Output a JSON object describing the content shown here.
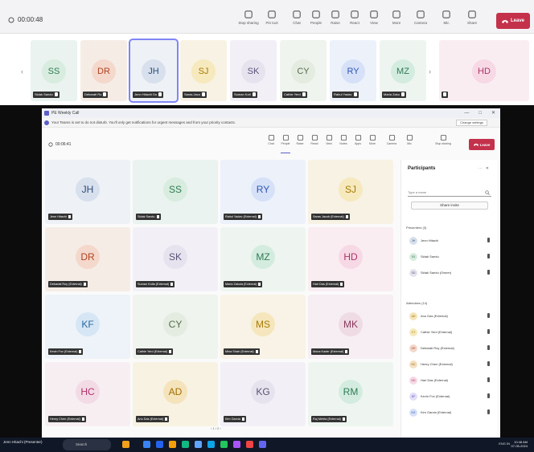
{
  "outer": {
    "timer": "00:00:48",
    "tools": [
      {
        "label": "Stop sharing",
        "icon": "stop-share-icon"
      },
      {
        "label": "Pin tool",
        "icon": "pin-tool-icon"
      },
      {
        "label": "Chat",
        "icon": "chat-icon"
      },
      {
        "label": "People",
        "icon": "people-icon"
      },
      {
        "label": "Raise",
        "icon": "raise-hand-icon"
      },
      {
        "label": "React",
        "icon": "react-icon"
      },
      {
        "label": "View",
        "icon": "view-icon"
      },
      {
        "label": "More",
        "icon": "more-icon"
      },
      {
        "label": "Camera",
        "icon": "camera-icon"
      },
      {
        "label": "Mic",
        "icon": "mic-icon"
      },
      {
        "label": "Share",
        "icon": "share-icon"
      }
    ],
    "leave_label": "Leave"
  },
  "strip": [
    {
      "initials": "SS",
      "name": "Sidak Sandu",
      "color": "#eaf3ef",
      "avatar": "#d8ecdf",
      "text": "#2f7c52"
    },
    {
      "initials": "DR",
      "name": "Debarati Ro",
      "color": "#f6ece6",
      "avatar": "#f4d8cc",
      "text": "#b0421f"
    },
    {
      "initials": "JH",
      "name": "Jenn Hitachi Do",
      "color": "#eef1f6",
      "avatar": "#d7e0ec",
      "text": "#2d4e7c"
    },
    {
      "initials": "SJ",
      "name": "Saras Jaco",
      "color": "#f7f2e4",
      "avatar": "#f6e9bd",
      "text": "#a77b04"
    },
    {
      "initials": "SK",
      "name": "Suman Kotl",
      "color": "#f2f0f6",
      "avatar": "#e6e3ee",
      "text": "#5b5378"
    },
    {
      "initials": "CY",
      "name": "Cathie Yerd",
      "color": "#eff4ee",
      "avatar": "#e4ece1",
      "text": "#556b4a"
    },
    {
      "initials": "RY",
      "name": "Rahul Yadav",
      "color": "#edf1fa",
      "avatar": "#d6e1f8",
      "text": "#2e56b3"
    },
    {
      "initials": "MZ",
      "name": "Maria Zaku",
      "color": "#eef5f0",
      "avatar": "#d4ece0",
      "text": "#2f7a53"
    }
  ],
  "strip_extra": {
    "initials": "HD",
    "color": "#f9edf2",
    "avatar": "#f6d9e5",
    "text": "#b1326a"
  },
  "inner": {
    "window_title": "PE Weekly Call",
    "window_controls": [
      "—",
      "□",
      "✕"
    ],
    "notice": "Your Teams is set to do not disturb. You'll only get notifications for urgent messages and from your priority contacts.",
    "notice_button": "Change settings",
    "timer": "00:06:41",
    "tools": [
      {
        "label": "Chat",
        "icon": "chat-icon"
      },
      {
        "label": "People",
        "icon": "people-icon",
        "active": true
      },
      {
        "label": "Raise",
        "icon": "raise-hand-icon"
      },
      {
        "label": "React",
        "icon": "react-icon"
      },
      {
        "label": "View",
        "icon": "view-icon"
      },
      {
        "label": "Notes",
        "icon": "notes-icon"
      },
      {
        "label": "Apps",
        "icon": "apps-icon"
      },
      {
        "label": "More",
        "icon": "more-icon"
      },
      {
        "label": "Camera",
        "icon": "camera-icon"
      },
      {
        "label": "Mic",
        "icon": "mic-icon"
      },
      {
        "label": "Stop sharing",
        "icon": "stop-share-icon"
      }
    ],
    "leave_label": "Leave",
    "tiles": [
      {
        "initials": "JH",
        "name": "Jenn Hitachi",
        "color": "#eef1f6",
        "avatar": "#d7e0ec",
        "text": "#2d4e7c"
      },
      {
        "initials": "SS",
        "name": "Sidak Sandu",
        "color": "#eaf3ef",
        "avatar": "#d8ecdf",
        "text": "#2f7c52"
      },
      {
        "initials": "RY",
        "name": "Rahul Yadav (External)",
        "color": "#edf1fa",
        "avatar": "#d6e1f8",
        "text": "#2e56b3"
      },
      {
        "initials": "SJ",
        "name": "Saras Jacob (External)",
        "color": "#f7f2e4",
        "avatar": "#f6e9bd",
        "text": "#a77b04"
      },
      {
        "initials": "DR",
        "name": "Debarati Roy (External)",
        "color": "#f6ece6",
        "avatar": "#f4d8cc",
        "text": "#b0421f"
      },
      {
        "initials": "SK",
        "name": "Suman Kotla (External)",
        "color": "#f2f0f6",
        "avatar": "#e6e3ee",
        "text": "#5b5378"
      },
      {
        "initials": "MZ",
        "name": "Maria Zakula (External)",
        "color": "#eef5f0",
        "avatar": "#d4ece0",
        "text": "#2f7a53"
      },
      {
        "initials": "HD",
        "name": "Hari Das (External)",
        "color": "#f9edf2",
        "avatar": "#f6d9e5",
        "text": "#b1326a"
      },
      {
        "initials": "KF",
        "name": "Kevin Fox (External)",
        "color": "#edf3f8",
        "avatar": "#d6e6f4",
        "text": "#2a6aa0"
      },
      {
        "initials": "CY",
        "name": "Cathie Yerd (External)",
        "color": "#eff4ee",
        "avatar": "#e4ece1",
        "text": "#556b4a"
      },
      {
        "initials": "MS",
        "name": "Mina Shah (External)",
        "color": "#f8f3e6",
        "avatar": "#f5e6bd",
        "text": "#a77b04"
      },
      {
        "initials": "MK",
        "name": "Mona Kader (External)",
        "color": "#f6eef2",
        "avatar": "#efdbe4",
        "text": "#8a3a5b"
      },
      {
        "initials": "HC",
        "name": "Henry Chen (External)",
        "color": "#f7eef2",
        "avatar": "#f3dbe6",
        "text": "#b1326a"
      },
      {
        "initials": "AD",
        "name": "Anu Das (External)",
        "color": "#f8f2e3",
        "avatar": "#f5e4bb",
        "text": "#a06d04"
      },
      {
        "initials": "KG",
        "name": "Kim Garcia",
        "color": "#f2f0f6",
        "avatar": "#e6e3ee",
        "text": "#5b5378"
      },
      {
        "initials": "RM",
        "name": "Raj Mehta (External)",
        "color": "#eef5f0",
        "avatar": "#d4ece0",
        "text": "#2f7a53"
      }
    ],
    "pager": "‹ 1 / 2 ›"
  },
  "panel": {
    "title": "Participants",
    "search_placeholder": "Type a name",
    "share_invite": "Share invite",
    "section_presenters": "Presenters (3)",
    "section_attendees": "Attendees (14)",
    "presenters": [
      {
        "initials": "JH",
        "name": "Jenn Hitachi",
        "avatar": "#d7e0ec",
        "text": "#2d4e7c"
      },
      {
        "initials": "SS",
        "name": "Sidak Sandu",
        "avatar": "#d8ecdf",
        "text": "#2f7c52"
      },
      {
        "initials": "SD",
        "name": "Sidak Sandu (Owner)",
        "avatar": "#e6e3ee",
        "text": "#5b5378"
      }
    ],
    "attendees": [
      {
        "initials": "AD",
        "name": "Anu Das (External)",
        "avatar": "#f5e4bb",
        "text": "#a06d04"
      },
      {
        "initials": "CY",
        "name": "Cathie Yerd (External)",
        "avatar": "#f6e9bd",
        "text": "#a77b04"
      },
      {
        "initials": "DR",
        "name": "Debarati Roy (External)",
        "avatar": "#f4d8cc",
        "text": "#b0421f"
      },
      {
        "initials": "HC",
        "name": "Henry Chen (External)",
        "avatar": "#f5e0c2",
        "text": "#a0620a"
      },
      {
        "initials": "HD",
        "name": "Hari Das (External)",
        "avatar": "#f6d9e5",
        "text": "#b1326a"
      },
      {
        "initials": "KF",
        "name": "Kevin Fox (External)",
        "avatar": "#e2def8",
        "text": "#4a3ea8"
      },
      {
        "initials": "KG",
        "name": "Kim Garcia (External)",
        "avatar": "#d6e1f8",
        "text": "#2e56b3"
      }
    ]
  },
  "taskbar": {
    "label": "Jenn Hitachi (Presenter)",
    "search": "Search",
    "right_status": "ENG IN",
    "time": "10:48 AM",
    "date": "07-05-2024"
  }
}
